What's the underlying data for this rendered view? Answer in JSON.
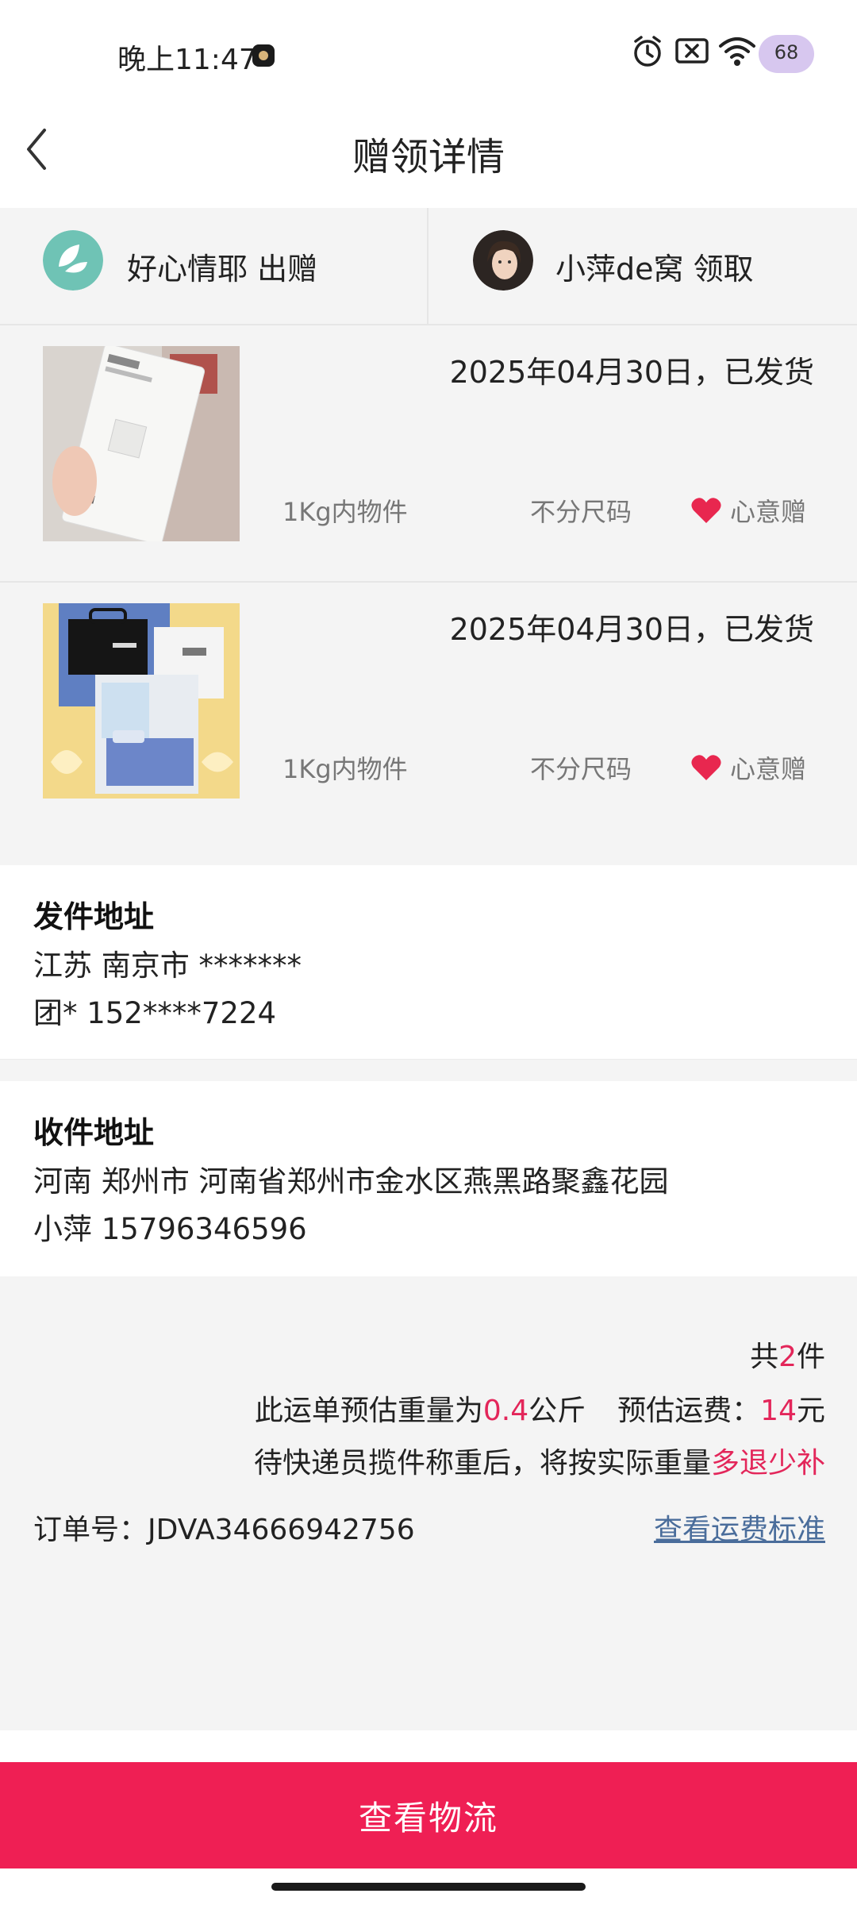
{
  "status_bar": {
    "time": "晚上11:47",
    "battery": "68"
  },
  "header": {
    "title": "赠领详情"
  },
  "parties": {
    "giver": {
      "name_text": "好心情耶 出赠"
    },
    "receiver": {
      "name_text": "小萍de窝 领取"
    }
  },
  "items": [
    {
      "status": "2025年04月30日，已发货",
      "weight": "1Kg内物件",
      "size": "不分尺码",
      "gift_label": "心意赠"
    },
    {
      "status": "2025年04月30日，已发货",
      "weight": "1Kg内物件",
      "size": "不分尺码",
      "gift_label": "心意赠"
    }
  ],
  "send_address": {
    "title": "发件地址",
    "region": "江苏 南京市 *******",
    "contact": "团* 152****7224"
  },
  "receive_address": {
    "title": "收件地址",
    "region": "河南 郑州市 河南省郑州市金水区燕黑路聚鑫花园",
    "contact": "小萍 15796346596"
  },
  "summary": {
    "count_prefix": "共",
    "count": "2",
    "count_suffix": "件",
    "weight_prefix": "此运单预估重量为",
    "weight": "0.4",
    "weight_unit": "公斤",
    "fee_prefix": "预估运费：",
    "fee": "14",
    "fee_unit": "元",
    "note_prefix": "待快递员揽件称重后，将按实际重量",
    "note_highlight": "多退少补",
    "order_label": "订单号：",
    "order_no": "JDVA34666942756",
    "fee_standard_link": "查看运费标准"
  },
  "cta": {
    "label": "查看物流"
  },
  "colors": {
    "accent": "#ef1f54",
    "highlight": "#e3265a",
    "link": "#4a6d9b"
  }
}
